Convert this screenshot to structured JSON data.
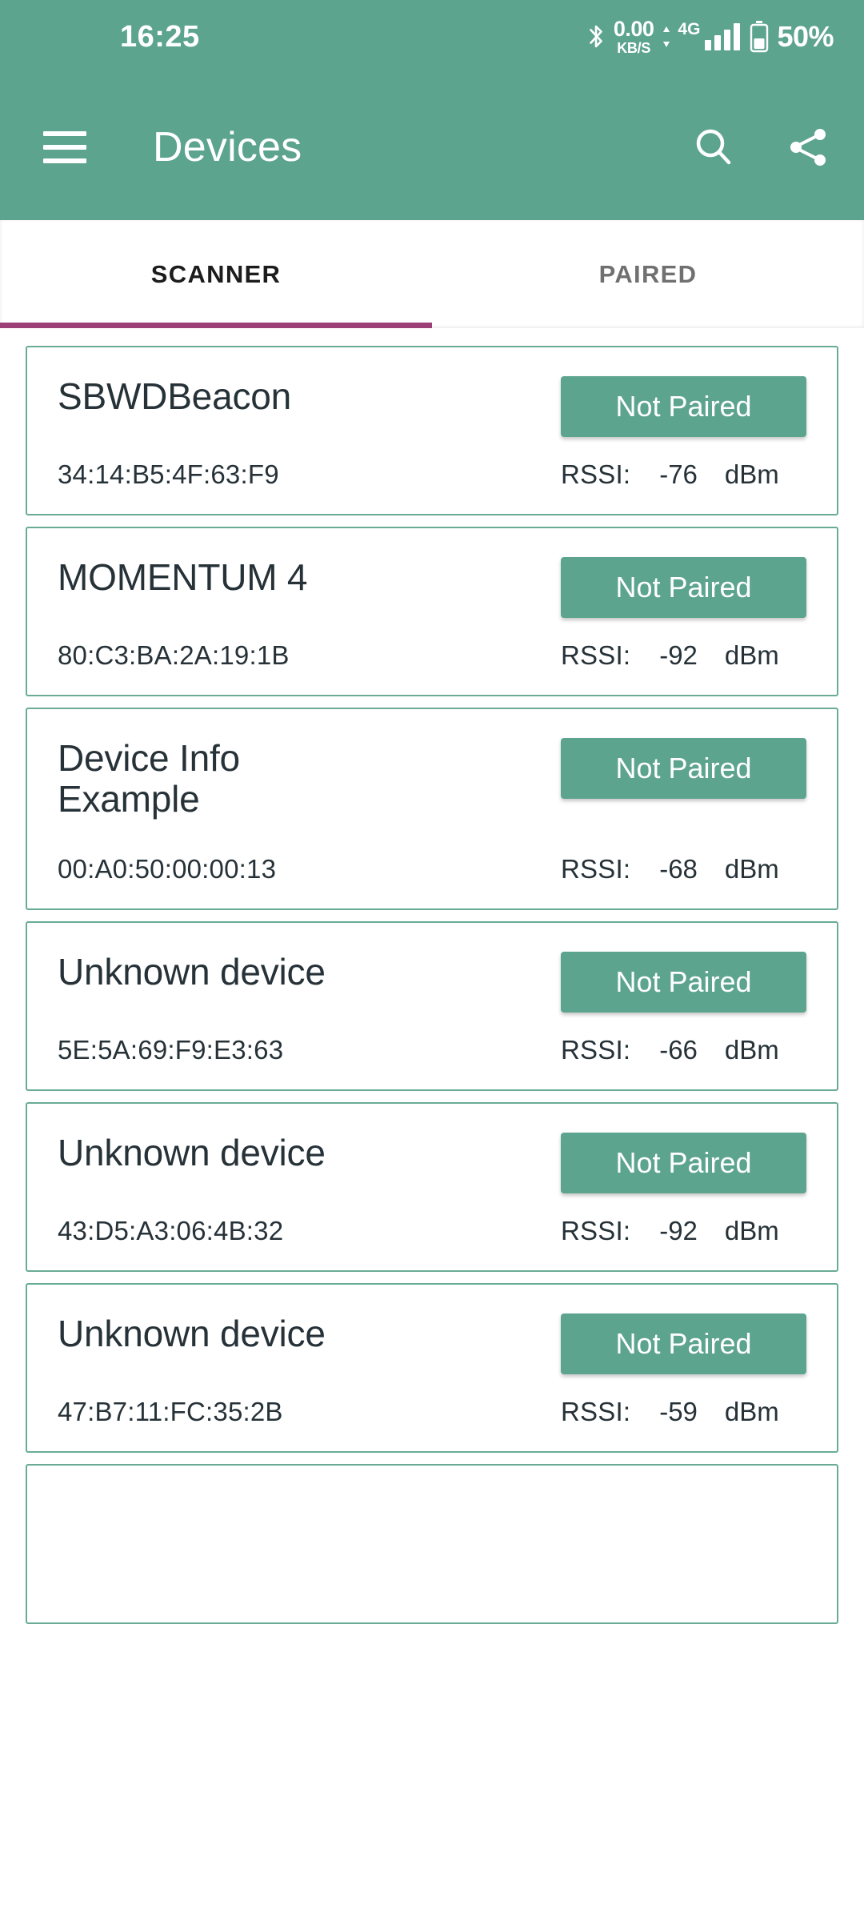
{
  "status_bar": {
    "time": "16:25",
    "bluetooth_icon": "bluetooth-icon",
    "net_speed_value": "0.00",
    "net_speed_unit": "KB/S",
    "updown_icon": "up-down-arrows-icon",
    "network_type": "4G",
    "signal_icon": "signal-bars-icon",
    "battery_icon": "battery-icon",
    "battery_percent": "50%"
  },
  "app_bar": {
    "menu_icon": "hamburger-menu-icon",
    "title": "Devices",
    "search_icon": "search-icon",
    "share_icon": "share-icon"
  },
  "tabs": {
    "items": [
      {
        "label": "SCANNER",
        "active": true
      },
      {
        "label": "PAIRED",
        "active": false
      }
    ],
    "indicator_color": "#9C3F76"
  },
  "colors": {
    "primary_green": "#5DA48F",
    "card_border": "#6AAB97",
    "text_dark": "#263238",
    "tab_indicator": "#9C3F76"
  },
  "labels": {
    "rssi_label": "RSSI:",
    "rssi_unit": "dBm"
  },
  "devices": [
    {
      "name": "SBWDBeacon",
      "mac": "34:14:B5:4F:63:F9",
      "pair_status": "Not Paired",
      "rssi": "-76"
    },
    {
      "name": "MOMENTUM 4",
      "mac": "80:C3:BA:2A:19:1B",
      "pair_status": "Not Paired",
      "rssi": "-92"
    },
    {
      "name": "Device Info Example",
      "mac": "00:A0:50:00:00:13",
      "pair_status": "Not Paired",
      "rssi": "-68"
    },
    {
      "name": "Unknown device",
      "mac": "5E:5A:69:F9:E3:63",
      "pair_status": "Not Paired",
      "rssi": "-66"
    },
    {
      "name": "Unknown device",
      "mac": "43:D5:A3:06:4B:32",
      "pair_status": "Not Paired",
      "rssi": "-92"
    },
    {
      "name": "Unknown device",
      "mac": "47:B7:11:FC:35:2B",
      "pair_status": "Not Paired",
      "rssi": "-59"
    }
  ]
}
